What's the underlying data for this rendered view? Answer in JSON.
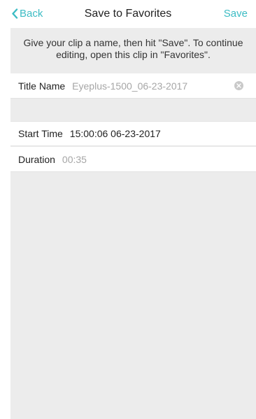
{
  "nav": {
    "back_label": "Back",
    "title": "Save to Favorites",
    "save_label": "Save"
  },
  "info": {
    "text": "Give your clip a name, then hit \"Save\". To continue editing, open this clip in \"Favorites\"."
  },
  "title_row": {
    "label": "Title Name",
    "value": "Eyeplus-1500_06-23-2017"
  },
  "start_row": {
    "label": "Start Time",
    "value": "15:00:06 06-23-2017"
  },
  "duration_row": {
    "label": "Duration",
    "value": "00:35"
  },
  "colors": {
    "accent": "#3cbcc4",
    "background_gray": "#ececec"
  },
  "icons": {
    "back": "chevron-left-icon",
    "clear": "clear-circle-icon"
  }
}
